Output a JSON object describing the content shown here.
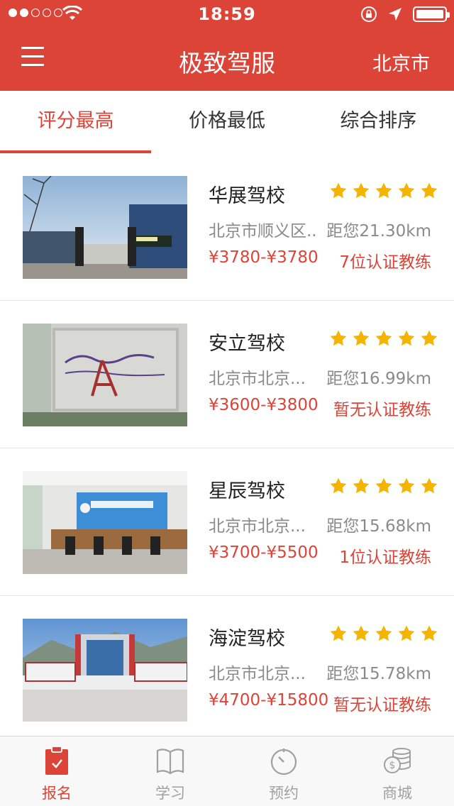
{
  "status_bar": {
    "time": "18:59",
    "signal_dots_filled": 2,
    "signal_dots_total": 5,
    "battery_level": 0.85
  },
  "header": {
    "title": "极致驾服",
    "city": "北京市",
    "menu_icon": "hamburger-menu-icon"
  },
  "tabs": [
    {
      "label": "评分最高",
      "active": true
    },
    {
      "label": "价格最低",
      "active": false
    },
    {
      "label": "综合排序",
      "active": false
    }
  ],
  "schools": [
    {
      "name": "华展驾校",
      "address": "北京市顺义区...",
      "distance": "距您21.30km",
      "price": "¥3780-¥3780",
      "coaches": "7位认证教练",
      "rating": 5
    },
    {
      "name": "安立驾校",
      "address": "北京市北京...",
      "distance": "距您16.99km",
      "price": "¥3600-¥3800",
      "coaches": "暂无认证教练",
      "rating": 5
    },
    {
      "name": "星辰驾校",
      "address": "北京市北京...",
      "distance": "距您15.68km",
      "price": "¥3700-¥5500",
      "coaches": "1位认证教练",
      "rating": 5
    },
    {
      "name": "海淀驾校",
      "address": "北京市北京...",
      "distance": "距您15.78km",
      "price": "¥4700-¥15800",
      "coaches": "暂无认证教练",
      "rating": 5
    }
  ],
  "bottom_nav": [
    {
      "label": "报名",
      "icon": "clipboard-icon",
      "active": true
    },
    {
      "label": "学习",
      "icon": "book-icon",
      "active": false
    },
    {
      "label": "预约",
      "icon": "clock-icon",
      "active": false
    },
    {
      "label": "商城",
      "icon": "coins-icon",
      "active": false
    }
  ],
  "colors": {
    "brand_red": "#dc4437",
    "star_yellow": "#f5b400",
    "secondary_text": "#8a8a8a",
    "nav_inactive": "#a0a0a0"
  }
}
